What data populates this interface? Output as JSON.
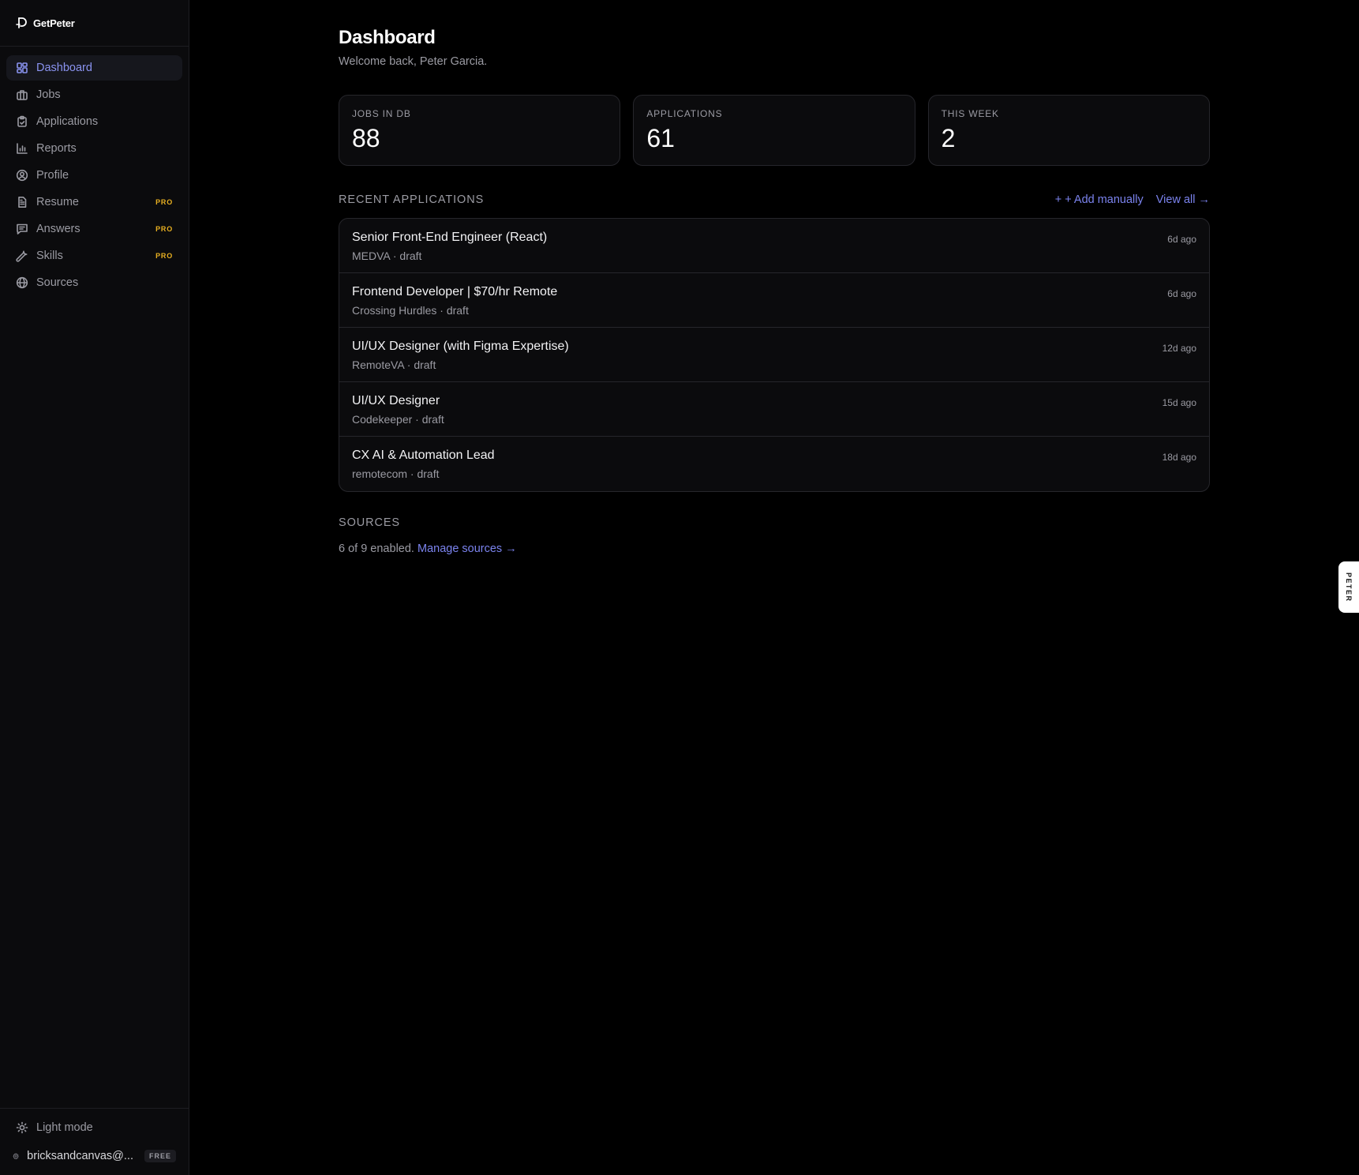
{
  "brand": {
    "name": "GetPeter"
  },
  "sidebar": {
    "items": [
      {
        "label": "Dashboard",
        "icon": "dashboard-icon",
        "badge": ""
      },
      {
        "label": "Jobs",
        "icon": "briefcase-icon",
        "badge": ""
      },
      {
        "label": "Applications",
        "icon": "clipboard-icon",
        "badge": ""
      },
      {
        "label": "Reports",
        "icon": "bar-chart-icon",
        "badge": ""
      },
      {
        "label": "Profile",
        "icon": "user-circle-icon",
        "badge": ""
      },
      {
        "label": "Resume",
        "icon": "document-icon",
        "badge": "PRO"
      },
      {
        "label": "Answers",
        "icon": "message-icon",
        "badge": "PRO"
      },
      {
        "label": "Skills",
        "icon": "wrench-icon",
        "badge": "PRO"
      },
      {
        "label": "Sources",
        "icon": "globe-icon",
        "badge": ""
      }
    ],
    "active": "Dashboard",
    "light_mode_label": "Light mode",
    "account_email": "bricksandcanvas@...",
    "plan_badge": "FREE"
  },
  "header": {
    "title": "Dashboard",
    "subtitle": "Welcome back, Peter Garcia."
  },
  "stats": [
    {
      "label": "JOBS IN DB",
      "value": "88"
    },
    {
      "label": "APPLICATIONS",
      "value": "61"
    },
    {
      "label": "THIS WEEK",
      "value": "2"
    }
  ],
  "recent": {
    "title": "RECENT APPLICATIONS",
    "add_label": "+ + Add manually",
    "view_all_label": "View all →",
    "rows": [
      {
        "title": "Senior Front-End Engineer (React)",
        "meta": "MEDVA · draft",
        "time": "6d ago"
      },
      {
        "title": "Frontend Developer | $70/hr Remote",
        "meta": "Crossing Hurdles · draft",
        "time": "6d ago"
      },
      {
        "title": "UI/UX Designer (with Figma Expertise)",
        "meta": "RemoteVA · draft",
        "time": "12d ago"
      },
      {
        "title": "UI/UX Designer",
        "meta": "Codekeeper · draft",
        "time": "15d ago"
      },
      {
        "title": "CX AI & Automation Lead",
        "meta": "remotecom · draft",
        "time": "18d ago"
      }
    ]
  },
  "sources": {
    "title": "SOURCES",
    "summary": "6 of 9 enabled.",
    "manage_label": "Manage sources →"
  },
  "side_tab": {
    "label": "PETER"
  },
  "colors": {
    "accent": "#7b83ee",
    "pro_badge": "#e8b021",
    "background": "#000000",
    "sidebar_bg": "#0b0b0d"
  }
}
